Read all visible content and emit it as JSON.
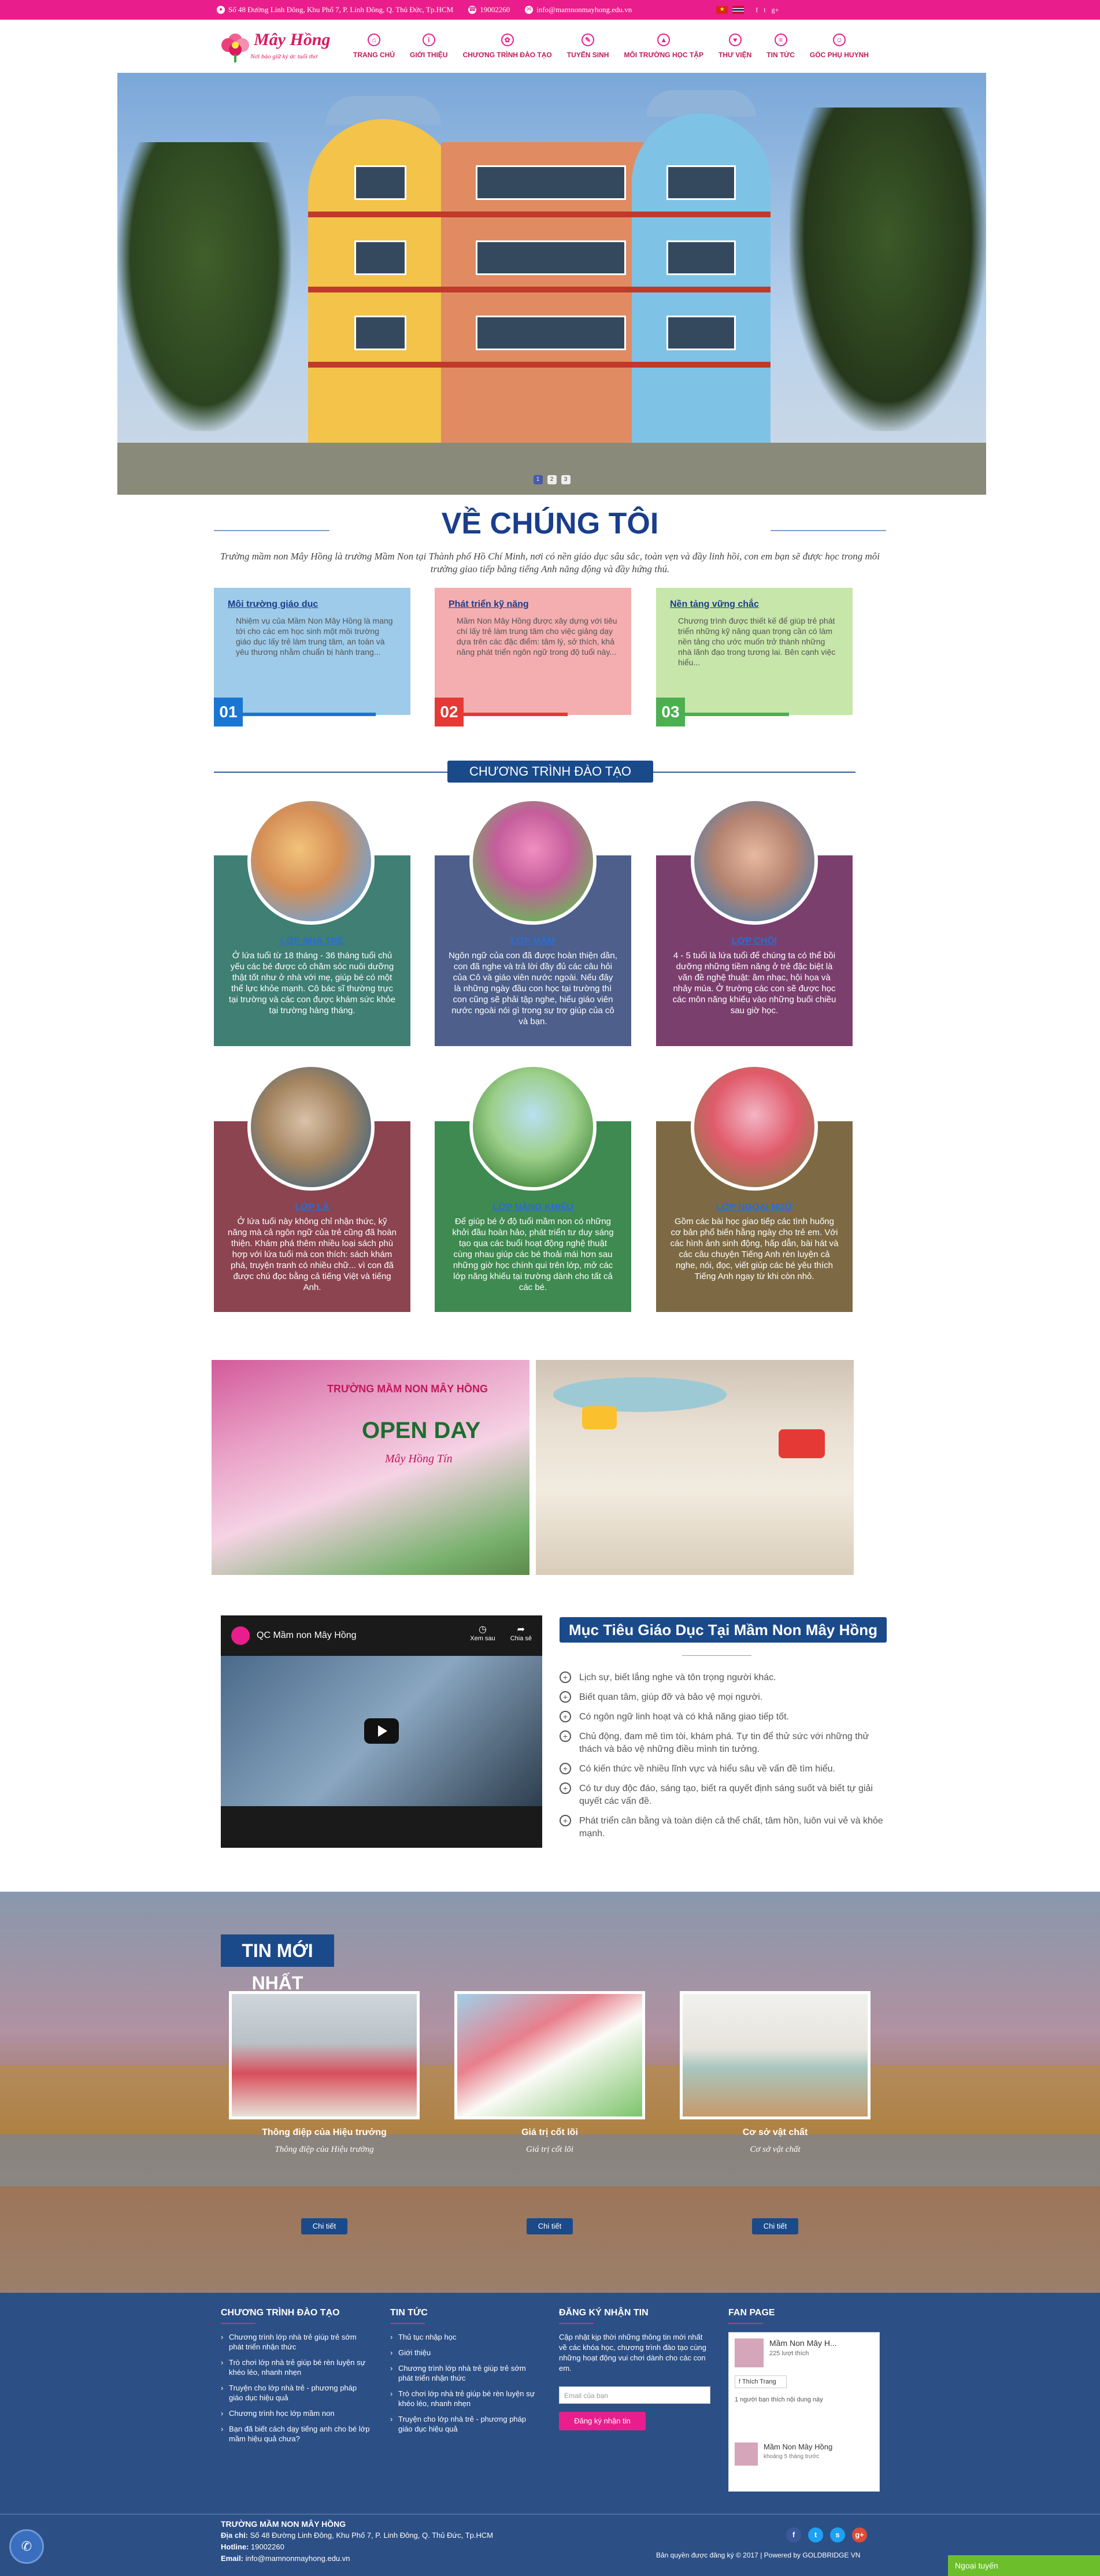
{
  "topbar": {
    "address": "Số 48 Đường Linh Đông, Khu Phố 7, P. Linh Đông, Q. Thủ Đức, Tp.HCM",
    "phone": "19002260",
    "email": "info@mamnonmayhong.edu.vn"
  },
  "logo": {
    "brand": "Mây Hồng",
    "slogan": "Nơi bảo giữ ký ức tuổi thơ"
  },
  "nav": [
    {
      "label": "TRANG CHỦ",
      "icon": "home-icon"
    },
    {
      "label": "GIỚI THIỆU",
      "icon": "info-icon"
    },
    {
      "label": "CHƯƠNG TRÌNH ĐÀO TẠO",
      "icon": "program-icon"
    },
    {
      "label": "TUYỂN SINH",
      "icon": "enroll-icon"
    },
    {
      "label": "MÔI TRƯỜNG HỌC TẬP",
      "icon": "school-icon"
    },
    {
      "label": "THƯ VIỆN",
      "icon": "gallery-icon"
    },
    {
      "label": "TIN TỨC",
      "icon": "news-icon"
    },
    {
      "label": "GÓC PHỤ HUYNH",
      "icon": "parents-icon"
    }
  ],
  "slider": {
    "dots": [
      "1",
      "2",
      "3"
    ],
    "active": 0
  },
  "about": {
    "title": "VỀ CHÚNG TÔI",
    "description": "Trường mầm non Mây Hồng là trường Mầm Non tại Thành phố Hồ Chí Minh, nơi có nền giáo dục sâu sắc, toàn vẹn và đầy linh hồi, con em bạn sẽ được học trong môi trường giao tiếp bằng tiếng Anh năng động và đầy hứng thú.",
    "boxes": [
      {
        "num": "01",
        "title": "Môi trường giáo dục",
        "text": "Nhiệm vụ của Mầm Non Mây Hồng là mang tới cho các em học sinh một môi trường giáo dục lấy trẻ làm trung tâm, an toàn và yêu thương nhằm chuẩn bị hành trang...",
        "bg": "#9ecbe9",
        "accent": "#1976d2"
      },
      {
        "num": "02",
        "title": "Phát triển kỹ năng",
        "text": "Mầm Non Mây Hồng được xây dựng với tiêu chí lấy trẻ làm trung tâm cho việc giảng dạy dựa trên các đặc điểm: tâm lý, sở thích, khả năng phát triển ngôn ngữ trong độ tuổi này...",
        "bg": "#f4aeb0",
        "accent": "#e53935"
      },
      {
        "num": "03",
        "title": "Nền tảng vững chắc",
        "text": "Chương trình được thiết kế để giúp trẻ phát triển những kỹ năng quan trọng cần có làm nền tảng cho ước muốn trở thành những nhà lãnh đạo trong tương lai. Bên cạnh việc hiểu...",
        "bg": "#c7e6a9",
        "accent": "#4caf50"
      }
    ]
  },
  "programs": {
    "heading": "CHƯƠNG TRÌNH ĐÀO TẠO",
    "items": [
      {
        "title": "LỚP NHÀ TRẺ",
        "text": "Ở lứa tuổi từ 18 tháng - 36 tháng tuổi chủ yếu các bé được cô chăm sóc nuôi dưỡng thật tốt như ở nhà với mẹ, giúp bé có một thể lực khỏe mạnh. Cô bác sĩ thường trực tại trường và các con được khám sức khỏe tại trường hàng tháng.",
        "bg": "#3f7f74"
      },
      {
        "title": "LỚP MẦM",
        "text": "Ngôn ngữ của con đã được hoàn thiện dần, con đã nghe và trả lời đầy đủ các câu hỏi của Cô và giáo viên nước ngoài. Nếu đây là những ngày đầu con học tại trường thì con cũng sẽ phải tập nghe, hiểu giáo viên nước ngoài nói gì trong sự trợ giúp của cô và bạn.",
        "bg": "#4d5f8a"
      },
      {
        "title": "LỚP CHỒI",
        "text": "4 - 5 tuổi là lứa tuổi để chúng ta có thể bồi dưỡng những tiềm năng ở trẻ đặc biệt là văn đề nghệ thuật: âm nhạc, hội họa và nhảy múa. Ở trường các con sẽ được học các môn năng khiếu vào những buổi chiều sau giờ học.",
        "bg": "#7b3f6e"
      },
      {
        "title": "LỚP LÁ",
        "text": "Ở lứa tuổi này không chỉ nhận thức, kỹ năng mà cả ngôn ngữ của trẻ cũng đã hoàn thiện. Khám phá thêm nhiều loại sách phù hợp với lứa tuổi mà con thích: sách khám phá, truyện tranh có nhiều chữ... vì con đã được chú đọc bằng cả tiếng Việt và tiếng Anh.",
        "bg": "#8b4450"
      },
      {
        "title": "LỚP NĂNG KHIẾU",
        "text": "Để giúp bé ở độ tuổi mầm non có những khởi đầu hoàn hảo, phát triển tư duy sáng tạo qua các buổi hoạt động nghệ thuật cùng nhau giúp các bé thoải mái hơn sau những giờ học chính qui trên lớp, mở các lớp năng khiếu tại trường dành cho tất cả các bé.",
        "bg": "#3f8a50"
      },
      {
        "title": "LỚP NGOẠI NGỮ",
        "text": "Gồm các bài học giao tiếp các tình huống cơ bản phổ biến hằng ngày cho trẻ em. Với các hình ảnh sinh động, hấp dẫn, bài hát và các câu chuyện Tiếng Anh rèn luyện cả nghe, nói, đọc, viết giúp các bé yêu thích Tiếng Anh ngay từ khi còn nhỏ.",
        "bg": "#7d6a44"
      }
    ]
  },
  "photos": {
    "banner_title": "TRƯỜNG MẦM NON MÂY HỒNG",
    "banner_big": "OPEN DAY",
    "banner_sub": "Mây Hồng Tín"
  },
  "video": {
    "channel": "QC Mầm non Mây Hồng",
    "later": "Xem sau",
    "share": "Chia sẻ"
  },
  "goals": {
    "title": "Mục Tiêu Giáo Dục Tại Mầm Non Mây Hồng",
    "items": [
      "Lịch sự, biết lắng nghe và tôn trọng người khác.",
      "Biết quan tâm, giúp đỡ và bảo vệ mọi người.",
      "Có ngôn ngữ linh hoạt và có khả năng giao tiếp tốt.",
      "Chủ động, đam mê tìm tòi, khám phá. Tự tin để thử sức với những thử thách và bảo vệ những điều mình tin tưởng.",
      "Có kiến thức về nhiều lĩnh vực và hiểu sâu về vấn đề tìm hiểu.",
      "Có tư duy độc đáo, sáng tạo, biết ra quyết định sáng suốt và biết tự giải quyết các vấn đề.",
      "Phát triển cân bằng và toàn diện cả thể chất, tâm hồn, luôn vui vẻ và khỏe mạnh."
    ]
  },
  "news": {
    "title": "TIN MỚI NHẤT",
    "button": "Chi tiết",
    "items": [
      {
        "title": "Thông điệp của Hiệu trưởng",
        "desc": "Thông điệp của Hiệu trưởng"
      },
      {
        "title": "Giá trị cốt lõi",
        "desc": "Giá trị cốt lõi"
      },
      {
        "title": "Cơ sở vật chất",
        "desc": "Cơ sở vật chất"
      }
    ]
  },
  "footer": {
    "col1": {
      "heading": "CHƯƠNG TRÌNH ĐÀO TẠO",
      "links": [
        "Chương trình lớp nhà trẻ giúp trẻ sớm phát triển nhận thức",
        "Trò chơi lớp nhà trẻ giúp bé rèn luyện sự khéo léo, nhanh nhẹn",
        "Truyện cho lớp nhà trẻ - phương pháp giáo dục hiệu quả",
        "Chương trình học lớp mầm non",
        "Bạn đã biết cách dạy tiếng anh cho bé lớp mầm hiệu quả chưa?"
      ]
    },
    "col2": {
      "heading": "TIN TỨC",
      "links": [
        "Thủ tục nhập học",
        "Giới thiệu",
        "Chương trình lớp nhà trẻ giúp trẻ sớm phát triển nhận thức",
        "Trò chơi lớp nhà trẻ giúp bé rèn luyện sự khéo léo, nhanh nhẹn",
        "Truyện cho lớp nhà trẻ - phương pháp giáo dục hiệu quả"
      ]
    },
    "col3": {
      "heading": "ĐĂNG KÝ NHẬN TIN",
      "text": "Cập nhật kịp thời những thông tin mới nhất về các khóa học, chương trình đào tạo cùng những hoạt động vui chơi dành cho các con em.",
      "placeholder": "Email của bạn",
      "button": "Đăng ký nhận tin"
    },
    "col4": {
      "heading": "FAN PAGE",
      "page_name": "Mầm Non Mây H...",
      "likes": "225 lượt thích",
      "like_btn": "Thích Trang",
      "note": "1 người bạn thích nội dung này",
      "post_name": "Mầm Non Mây Hồng",
      "post_time": "khoảng 5 tháng trước"
    },
    "info": {
      "name": "TRƯỜNG MẦM NON MÂY HỒNG",
      "address_label": "Địa chỉ:",
      "address": "Số 48 Đường Linh Đông, Khu Phố 7, P. Linh Đông, Q. Thủ Đức, Tp.HCM",
      "hotline_label": "Hotline:",
      "hotline": "19002260",
      "email_label": "Email:",
      "email": "info@mamnonmayhong.edu.vn"
    },
    "copyright": "Bản quyền được đăng ký © 2017  |  Powered by GOLDBRIDGE VN",
    "offline": "Ngoại tuyến"
  }
}
